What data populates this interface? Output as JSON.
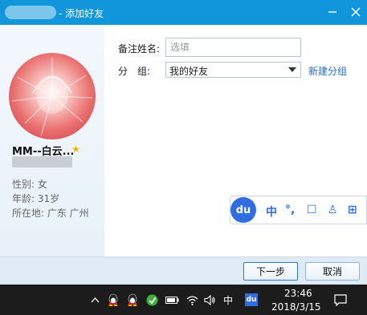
{
  "window": {
    "title": "- 添加好友",
    "minimize_icon": "minimize-icon",
    "close_icon": "close-icon"
  },
  "profile": {
    "nickname": "MM--白云...",
    "star_icon": "star-icon",
    "gender": "性别: 女",
    "age": "年龄: 31岁",
    "location": "所在地: 广东  广州"
  },
  "form": {
    "remark_label": "备注姓名:",
    "remark_placeholder": "选填",
    "group_label": "分　组:",
    "group_value": "我的好友",
    "new_group_link": "新建分组"
  },
  "ime_toolbar": {
    "logo": "du",
    "items": [
      "中",
      "°,",
      "☐",
      "♙",
      "⊞"
    ]
  },
  "buttons": {
    "next": "下一步",
    "cancel": "取消"
  },
  "taskbar": {
    "ime_indicator": "中",
    "ime_logo": "du",
    "time": "23:46",
    "date": "2018/3/15"
  },
  "colors": {
    "titlebar": "#1296db",
    "link": "#1f6fc2",
    "ime_accent": "#2f6de1"
  }
}
